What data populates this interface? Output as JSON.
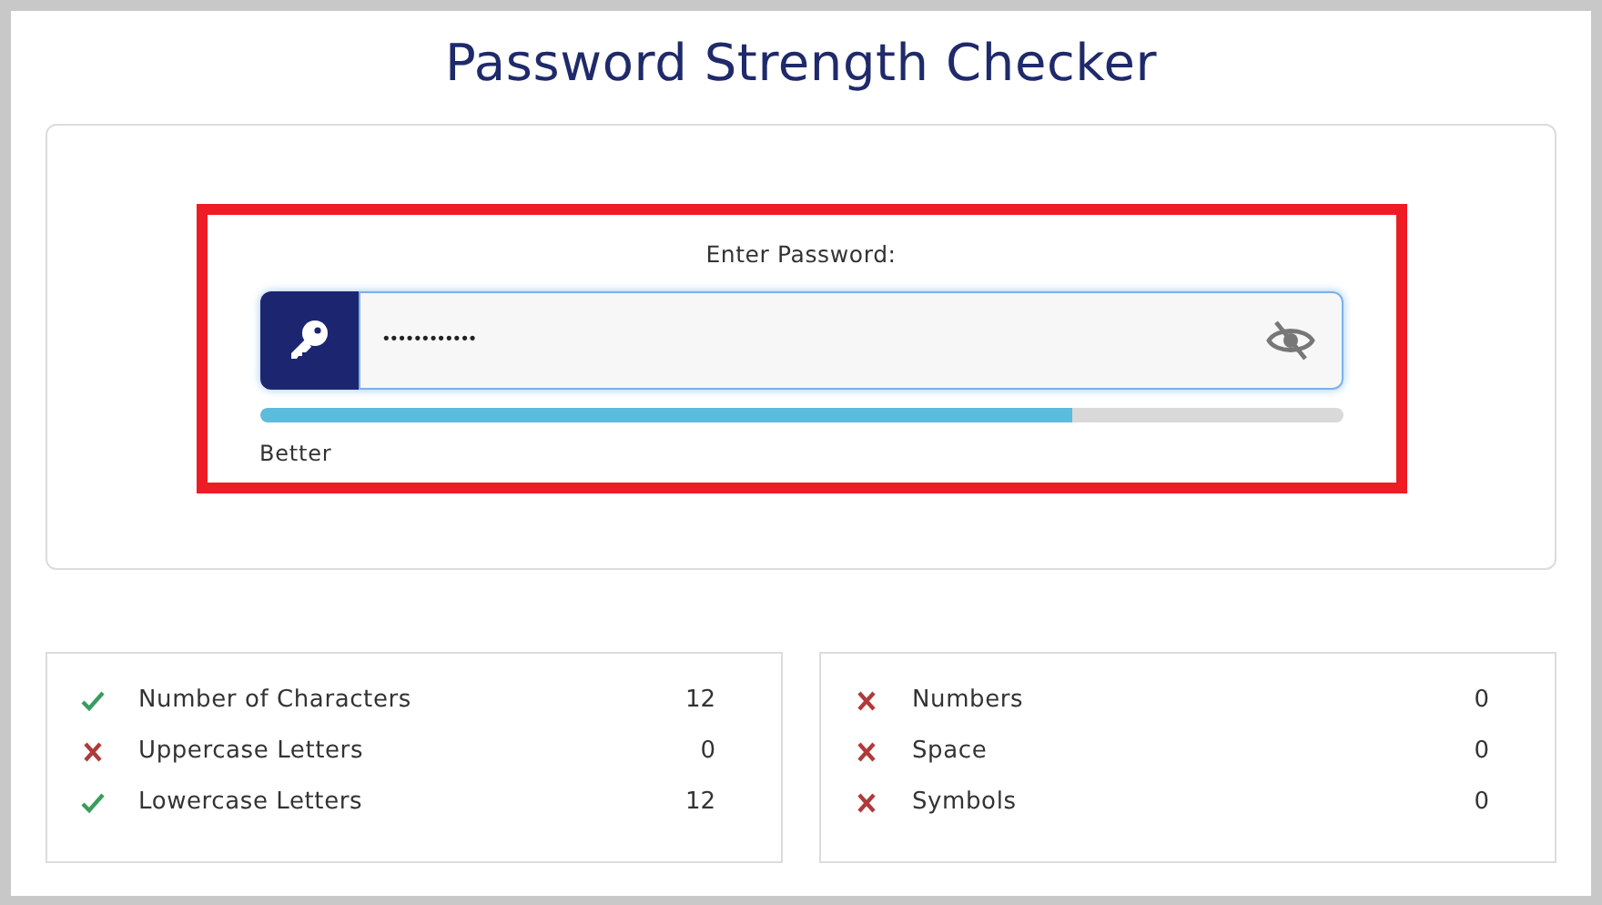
{
  "title": "Password Strength Checker",
  "password": {
    "label": "Enter Password:",
    "value": "••••••••••••",
    "visible": false
  },
  "strength": {
    "level": 0.75,
    "label": "Better"
  },
  "criteria_left": [
    {
      "label": "Number of Characters",
      "count": "12",
      "met": true
    },
    {
      "label": "Uppercase Letters",
      "count": "0",
      "met": false
    },
    {
      "label": "Lowercase Letters",
      "count": "12",
      "met": true
    }
  ],
  "criteria_right": [
    {
      "label": "Numbers",
      "count": "0",
      "met": false
    },
    {
      "label": "Space",
      "count": "0",
      "met": false
    },
    {
      "label": "Symbols",
      "count": "0",
      "met": false
    }
  ]
}
